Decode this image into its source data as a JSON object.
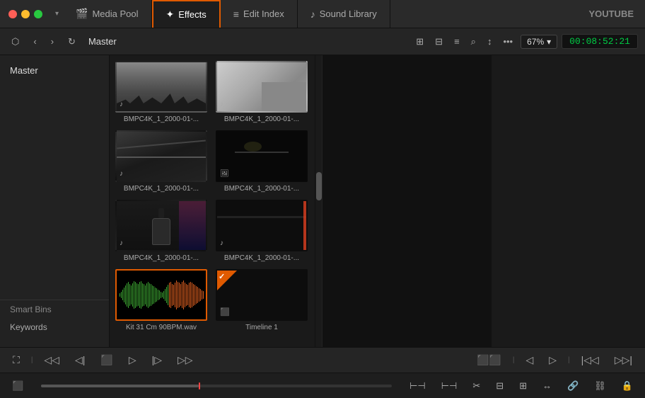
{
  "window": {
    "title": "YOUTUBE",
    "timecode": "00:08:52:21",
    "zoom": "67%"
  },
  "tabs": [
    {
      "id": "media-pool",
      "label": "Media Pool",
      "icon": "🎬",
      "active": false
    },
    {
      "id": "effects",
      "label": "Effects",
      "icon": "✨",
      "active": true
    },
    {
      "id": "edit-index",
      "label": "Edit Index",
      "icon": "☰",
      "active": false
    },
    {
      "id": "sound-library",
      "label": "Sound Library",
      "icon": "🎵",
      "active": false
    }
  ],
  "toolbar": {
    "master_label": "Master",
    "zoom_label": "67%",
    "timecode": "00:08:52:21"
  },
  "sidebar": {
    "master": "Master",
    "smart_bins": "Smart Bins",
    "keywords": "Keywords"
  },
  "media_items": [
    {
      "id": 1,
      "label": "BMPC4K_1_2000-01-...",
      "type": "audio",
      "selected": false,
      "thumb_class": "thumb-scene1"
    },
    {
      "id": 2,
      "label": "BMPC4K_1_2000-01-...",
      "type": "audio",
      "selected": false,
      "thumb_class": "thumb-scene2"
    },
    {
      "id": 3,
      "label": "BMPC4K_1_2000-01-...",
      "type": "audio",
      "selected": false,
      "thumb_class": "thumb-scene3"
    },
    {
      "id": 4,
      "label": "BMPC4K_1_2000-01-...",
      "type": "image",
      "selected": false,
      "thumb_class": "thumb-scene4"
    },
    {
      "id": 5,
      "label": "BMPC4K_1_2000-01-...",
      "type": "audio",
      "selected": false,
      "thumb_class": "thumb-scene5"
    },
    {
      "id": 6,
      "label": "BMPC4K_1_2000-01-...",
      "type": "audio",
      "selected": false,
      "thumb_class": "thumb-scene6"
    },
    {
      "id": 7,
      "label": "Kit 31 Cm 90BPM.wav",
      "type": "waveform",
      "selected": true,
      "thumb_class": "thumb-audio"
    },
    {
      "id": 8,
      "label": "Timeline 1",
      "type": "timeline",
      "selected": false,
      "thumb_class": "thumb-timeline"
    }
  ],
  "transport_buttons": [
    "⏮",
    "⏪",
    "⏹",
    "⏺",
    "▶",
    "⏩"
  ],
  "status_bar": {
    "icon": "⬛"
  }
}
